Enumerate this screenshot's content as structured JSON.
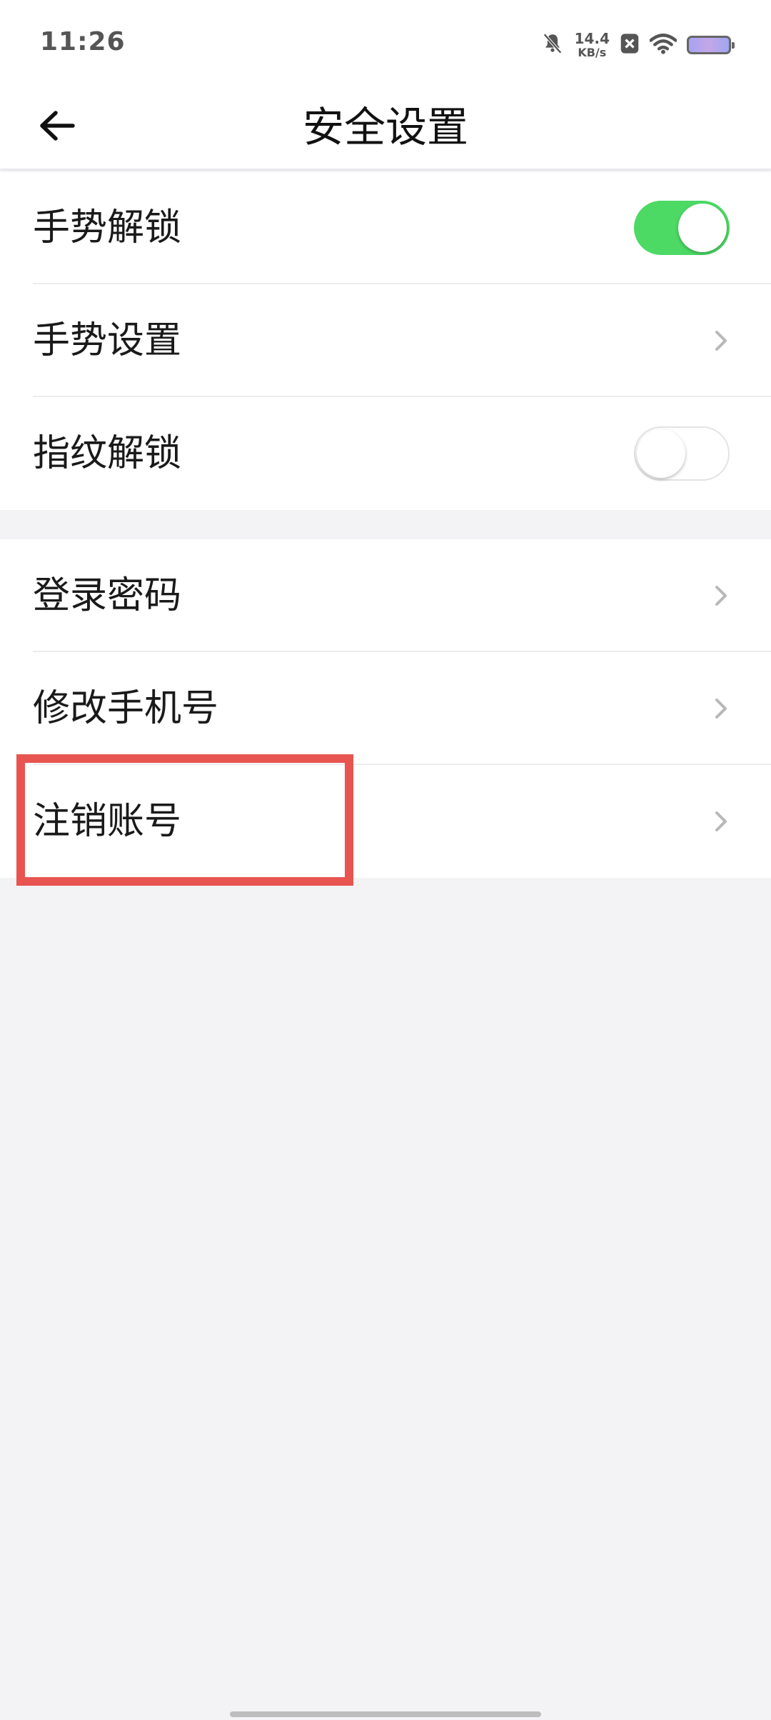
{
  "status_bar": {
    "time": "11:26",
    "net_speed_value": "14.4",
    "net_speed_unit": "KB/s",
    "icons": [
      "mute-bell-icon",
      "close-notification-icon",
      "wifi-icon",
      "battery-icon"
    ]
  },
  "header": {
    "title": "安全设置",
    "back_icon": "arrow-left-icon"
  },
  "groups": [
    {
      "items": [
        {
          "label": "手势解锁",
          "control": "toggle",
          "toggle_on": true
        },
        {
          "label": "手势设置",
          "control": "chevron"
        },
        {
          "label": "指纹解锁",
          "control": "toggle",
          "toggle_on": false
        }
      ]
    },
    {
      "items": [
        {
          "label": "登录密码",
          "control": "chevron"
        },
        {
          "label": "修改手机号",
          "control": "chevron"
        },
        {
          "label": "注销账号",
          "control": "chevron",
          "highlighted": true
        }
      ]
    }
  ],
  "colors": {
    "toggle_on": "#4cd964",
    "highlight": "#e8544f",
    "background": "#f3f3f6"
  }
}
